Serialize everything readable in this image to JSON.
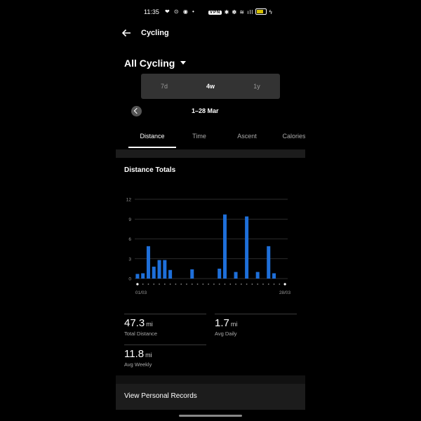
{
  "status": {
    "time": "11:35",
    "left_icons": "❤ ⊙ ◉ •",
    "vpn": "VPN",
    "right_icons": "✱ ✽ ≋ ıll"
  },
  "header": {
    "title": "Cycling"
  },
  "filter": {
    "activity": "All Cycling"
  },
  "range": {
    "options": [
      "7d",
      "4w",
      "1y"
    ],
    "selected": "4w"
  },
  "date": {
    "label": "1–28 Mar"
  },
  "tabs": [
    "Distance",
    "Time",
    "Ascent",
    "Calories"
  ],
  "section": {
    "title": "Distance Totals"
  },
  "chart_data": {
    "type": "bar",
    "title": "Distance Totals",
    "xlabel": "",
    "ylabel": "",
    "ylim": [
      0,
      12
    ],
    "yticks": [
      "12",
      "9",
      "6",
      "3",
      "0"
    ],
    "x_start_label": "01/03",
    "x_end_label": "28/03",
    "categories": [
      "1",
      "2",
      "3",
      "4",
      "5",
      "6",
      "7",
      "8",
      "9",
      "10",
      "11",
      "12",
      "13",
      "14",
      "15",
      "16",
      "17",
      "18",
      "19",
      "20",
      "21",
      "22",
      "23",
      "24",
      "25",
      "26",
      "27",
      "28"
    ],
    "values": [
      0.7,
      0.8,
      4.9,
      1.8,
      2.8,
      2.8,
      1.3,
      0,
      0,
      0,
      1.4,
      0,
      0,
      0,
      0,
      1.5,
      9.7,
      0,
      1,
      0,
      9.4,
      0,
      1,
      0,
      4.9,
      0.8,
      0,
      0
    ],
    "color": "#1e6fd9",
    "grid": true
  },
  "stats": {
    "total_distance": {
      "value": "47.3",
      "unit": "mi",
      "label": "Total Distance"
    },
    "avg_daily": {
      "value": "1.7",
      "unit": "mi",
      "label": "Avg Daily"
    },
    "avg_weekly": {
      "value": "11.8",
      "unit": "mi",
      "label": "Avg Weekly"
    }
  },
  "records": {
    "label": "View Personal Records"
  }
}
